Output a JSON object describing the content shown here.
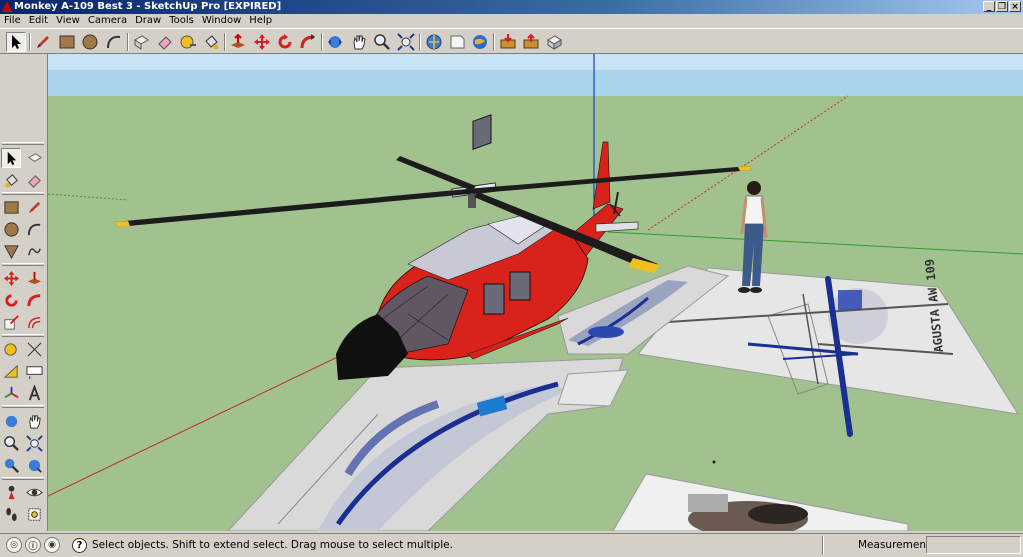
{
  "window": {
    "title": "Monkey A-109 Best 3 - SketchUp Pro [EXPIRED]",
    "controls": [
      "_",
      "❐",
      "×"
    ]
  },
  "menu": [
    "File",
    "Edit",
    "View",
    "Camera",
    "Draw",
    "Tools",
    "Window",
    "Help"
  ],
  "toolbar": {
    "tools": [
      "select",
      "pencil",
      "rectangle",
      "circle",
      "arc",
      "make-component",
      "eraser",
      "tape-measure",
      "paint-bucket",
      "push-pull",
      "move",
      "rotate",
      "follow-me",
      "orbit",
      "pan",
      "zoom",
      "zoom-extents",
      "previous-view",
      "next-view",
      "top-view",
      "get-models",
      "share-model",
      "share-component"
    ]
  },
  "left_toolbar": {
    "tools": [
      "select",
      "eraser",
      "paint-bucket",
      "erase-alt",
      "rectangle",
      "line",
      "circle",
      "arc",
      "polygon",
      "freehand",
      "move",
      "push-pull",
      "rotate",
      "follow-me",
      "scale",
      "offset",
      "tape-measure",
      "dimension",
      "protractor",
      "text",
      "axes",
      "3d-text",
      "orbit",
      "pan",
      "zoom",
      "zoom-window",
      "zoom-extents",
      "previous",
      "position-camera",
      "look-around",
      "walk",
      "section-plane"
    ]
  },
  "status": {
    "message": "Select objects. Shift to extend select. Drag mouse to select multiple.",
    "measurements_label": "Measurements",
    "measurements_value": "",
    "help_glyph": "?"
  },
  "colors": {
    "sky": "#a8d4ec",
    "ground": "#a1c28f",
    "helicopter_red": "#d9221a",
    "axis_red": "#c62828",
    "axis_green": "#2e9d2e",
    "axis_blue": "#1a3ccf"
  },
  "scene": {
    "blueprint_text": "AGUSTA AW 109"
  }
}
